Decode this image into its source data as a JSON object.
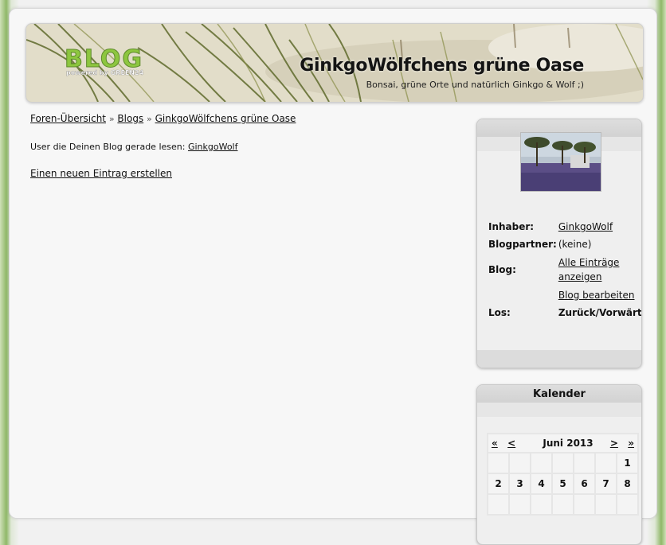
{
  "banner": {
    "logo_text": "BLOG",
    "logo_sub": "powered by GREEN24",
    "title": "GinkgoWölfchens grüne Oase",
    "subtitle": "Bonsai, grüne Orte und natürlich Ginkgo & Wolf ;)"
  },
  "breadcrumb": {
    "items": [
      "Foren-Übersicht",
      "Blogs",
      "GinkgoWölfchens grüne Oase"
    ],
    "separator": "»"
  },
  "readers": {
    "label": "User die Deinen Blog gerade lesen:",
    "user": "GinkgoWolf"
  },
  "actions": {
    "new_entry": "Einen neuen Eintrag erstellen"
  },
  "profile": {
    "owner_label": "Inhaber:",
    "owner_value": "GinkgoWolf",
    "partner_label": "Blogpartner:",
    "partner_value": "(keine)",
    "blog_label": "Blog:",
    "blog_link": "Alle Einträge anzeigen",
    "edit_link": "Blog bearbeiten",
    "go_label": "Los:",
    "go_value": "Zurück/Vorwärts"
  },
  "calendar": {
    "title": "Kalender",
    "prev_year": "«",
    "prev_month": "<",
    "month": "Juni 2013",
    "next_month": ">",
    "next_year": "»",
    "week1": [
      "",
      "",
      "",
      "",
      "",
      "",
      "1"
    ],
    "week2": [
      "2",
      "3",
      "4",
      "5",
      "6",
      "7",
      "8"
    ]
  }
}
